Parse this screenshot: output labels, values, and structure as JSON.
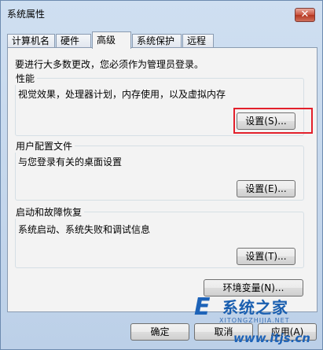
{
  "window": {
    "title": "系统属性",
    "close_glyph": "✕"
  },
  "tabs": [
    {
      "label": "计算机名",
      "active": false
    },
    {
      "label": "硬件",
      "active": false
    },
    {
      "label": "高级",
      "active": true
    },
    {
      "label": "系统保护",
      "active": false
    },
    {
      "label": "远程",
      "active": false
    }
  ],
  "admin_note": "要进行大多数更改，您必须作为管理员登录。",
  "groups": {
    "performance": {
      "title": "性能",
      "desc": "视觉效果，处理器计划，内存使用，以及虚拟内存",
      "button": "设置(S)..."
    },
    "user_profiles": {
      "title": "用户配置文件",
      "desc": "与您登录有关的桌面设置",
      "button": "设置(E)..."
    },
    "startup_recovery": {
      "title": "启动和故障恢复",
      "desc": "系统启动、系统失败和调试信息",
      "button": "设置(T)..."
    }
  },
  "env_button": "环境变量(N)...",
  "footer": {
    "ok": "确定",
    "cancel": "取消",
    "apply": "应用(A)"
  },
  "watermark": {
    "logo": "E",
    "brand": "系统之家",
    "sub": "XITONGZHIJIA.NET",
    "url": "www.itjs.cn"
  },
  "colors": {
    "highlight": "#e3202b",
    "brand": "#1d63b8"
  }
}
